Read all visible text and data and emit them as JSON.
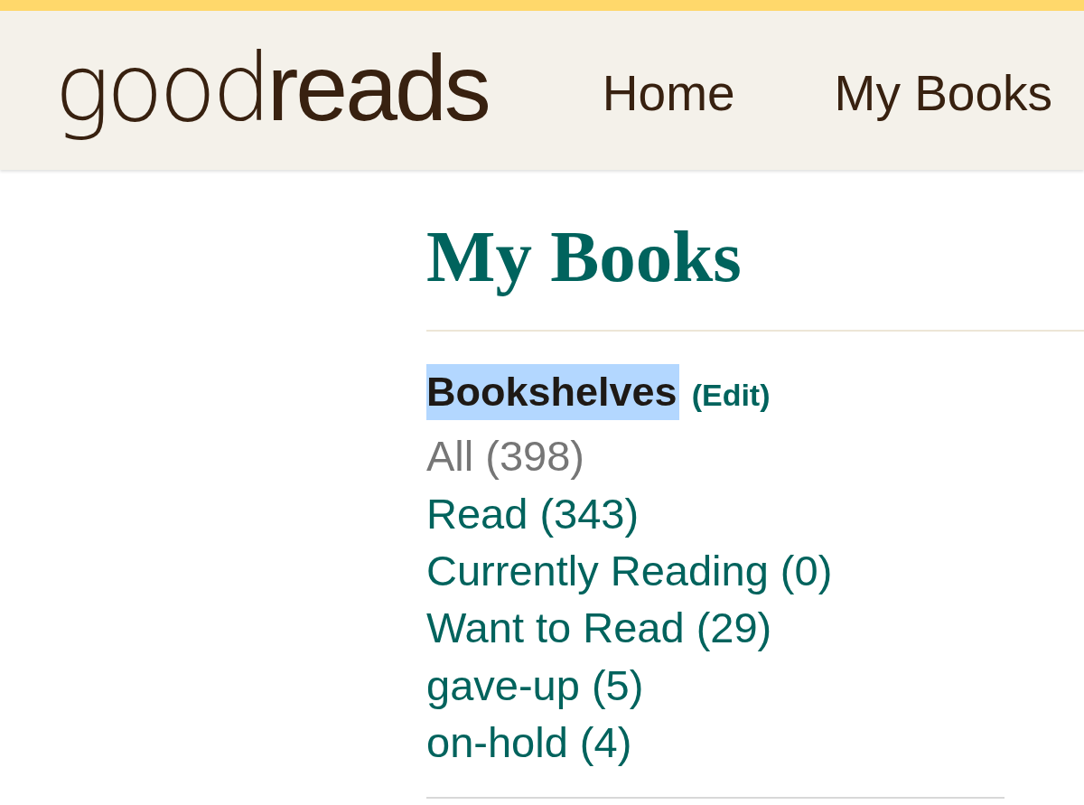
{
  "header": {
    "logo": "good**reads**",
    "nav": [
      {
        "label": "Home"
      },
      {
        "label": "My Books"
      }
    ]
  },
  "page_title": "My Books",
  "bookshelves": {
    "title": "Bookshelves",
    "highlighted": true,
    "edit_link": "(Edit)",
    "shelves": [
      {
        "label": "All (398)",
        "selected": true
      },
      {
        "label": "Read (343)",
        "selected": false
      },
      {
        "label": "Currently Reading (0)",
        "selected": false
      },
      {
        "label": "Want to Read (29)",
        "selected": false
      },
      {
        "label": "gave-up (5)",
        "selected": false
      },
      {
        "label": "on-hold (4)",
        "selected": false
      }
    ]
  }
}
